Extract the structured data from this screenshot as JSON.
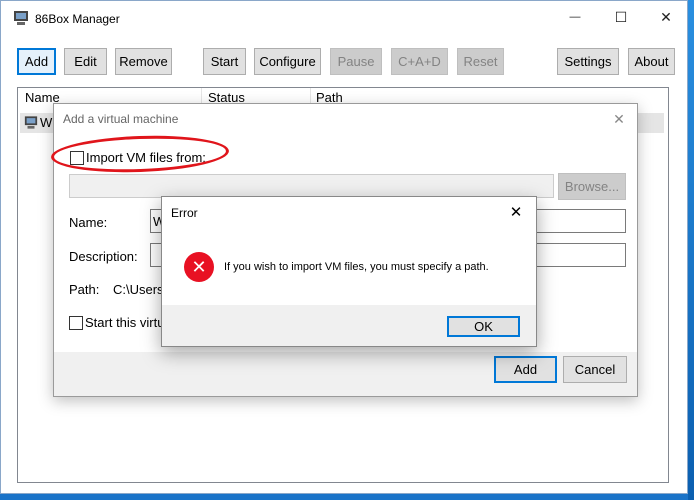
{
  "window": {
    "title": "86Box Manager",
    "minimize_glyph": "—",
    "maximize_glyph": "☐",
    "close_glyph": "✕"
  },
  "toolbar": {
    "add": "Add",
    "edit": "Edit",
    "remove": "Remove",
    "start": "Start",
    "configure": "Configure",
    "pause": "Pause",
    "cad": "C+A+D",
    "reset": "Reset",
    "settings": "Settings",
    "about": "About"
  },
  "list": {
    "columns": [
      "Name",
      "Status",
      "Path"
    ],
    "rows": [
      {
        "name": "Wi"
      }
    ]
  },
  "add_dialog": {
    "title": "Add a virtual machine",
    "close_glyph": "✕",
    "import_label": "Import VM files from:",
    "browse": "Browse...",
    "name_label": "Name:",
    "name_value": "W",
    "description_label": "Description:",
    "path_label": "Path:",
    "path_value": "C:\\Users",
    "start_label": "Start this virtu",
    "add_button": "Add",
    "cancel_button": "Cancel"
  },
  "error_dialog": {
    "title": "Error",
    "close_glyph": "✕",
    "icon_glyph": "✕",
    "message": "If you wish to import VM files, you must specify a path.",
    "ok": "OK"
  },
  "colors": {
    "accent": "#0078d7",
    "error_red": "#e81123",
    "annotation_red": "#e0151b",
    "desktop_blue": "#1a73c8"
  }
}
